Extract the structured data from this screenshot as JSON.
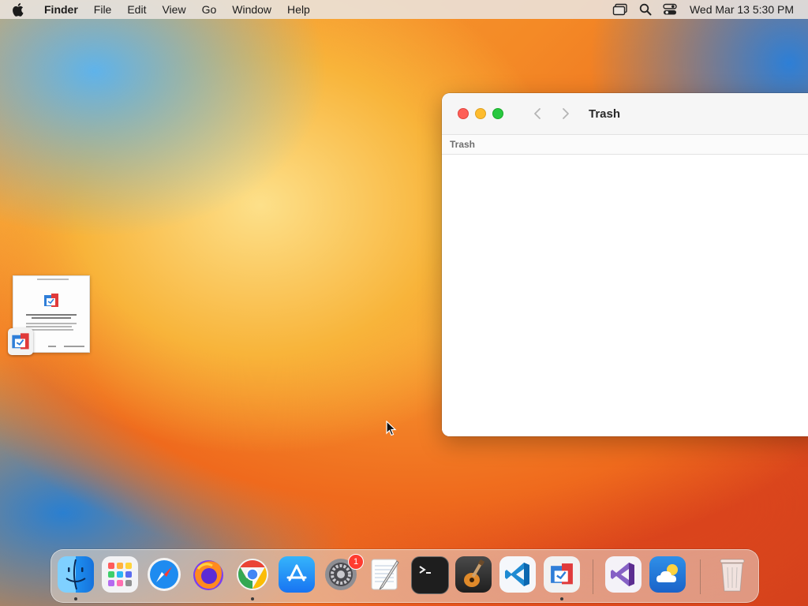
{
  "menubar": {
    "app_name": "Finder",
    "items": [
      "File",
      "Edit",
      "View",
      "Go",
      "Window",
      "Help"
    ],
    "status_icons": [
      "screen-mirroring-icon",
      "spotlight-search-icon",
      "control-center-icon"
    ],
    "clock": "Wed Mar 13  5:30 PM"
  },
  "finder_window": {
    "title": "Trash",
    "path_label": "Trash"
  },
  "dock": {
    "apps": [
      "Finder",
      "Launchpad",
      "Safari",
      "Firefox",
      "Google Chrome",
      "App Store",
      "System Settings",
      "TextEdit",
      "Terminal",
      "GarageBand",
      "Visual Studio Code",
      "Migration App",
      "Visual Studio",
      "Weather",
      "Trash"
    ],
    "system_settings_badge": "1"
  },
  "colors": {
    "accent_red": "#fe5f57",
    "accent_yellow": "#febc2e",
    "accent_green": "#28c840",
    "badge_red": "#ff3b30"
  }
}
